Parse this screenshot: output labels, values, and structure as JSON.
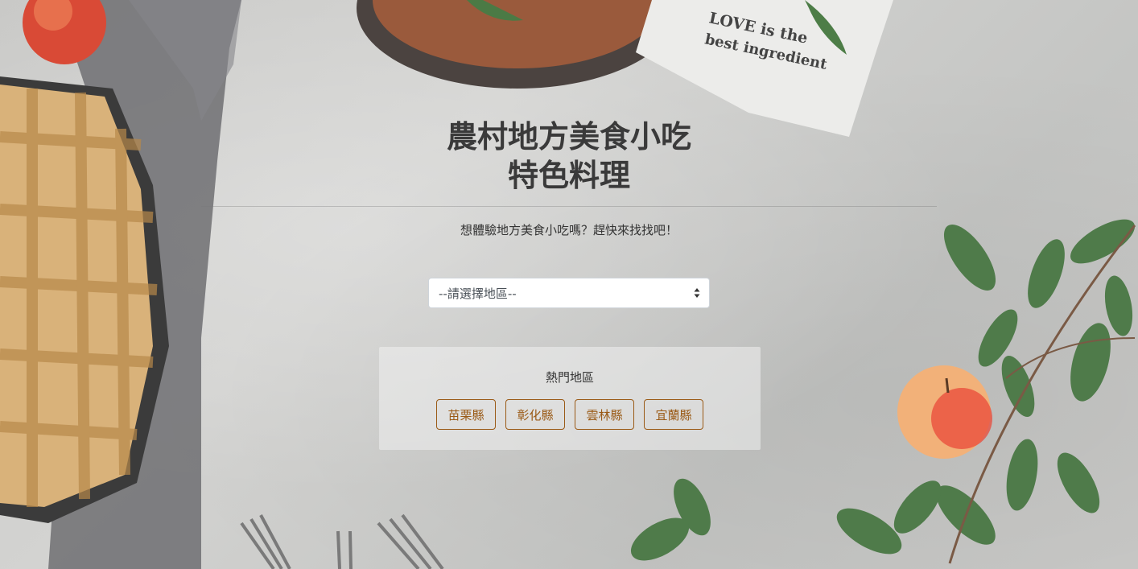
{
  "background": {
    "napkin_text_line1": "LOVE is the",
    "napkin_text_line2": "best ingredient"
  },
  "header": {
    "title_line1": "農村地方美食小吃",
    "title_line2": "特色料理",
    "subtitle": "想體驗地方美食小吃嗎？趕快來找找吧！"
  },
  "region_select": {
    "selected": "--請選擇地區--"
  },
  "popular": {
    "title": "熱門地區",
    "buttons": [
      "苗栗縣",
      "彰化縣",
      "雲林縣",
      "宜蘭縣"
    ]
  },
  "colors": {
    "accent": "#9a5a16",
    "title": "#3a3a3a"
  }
}
